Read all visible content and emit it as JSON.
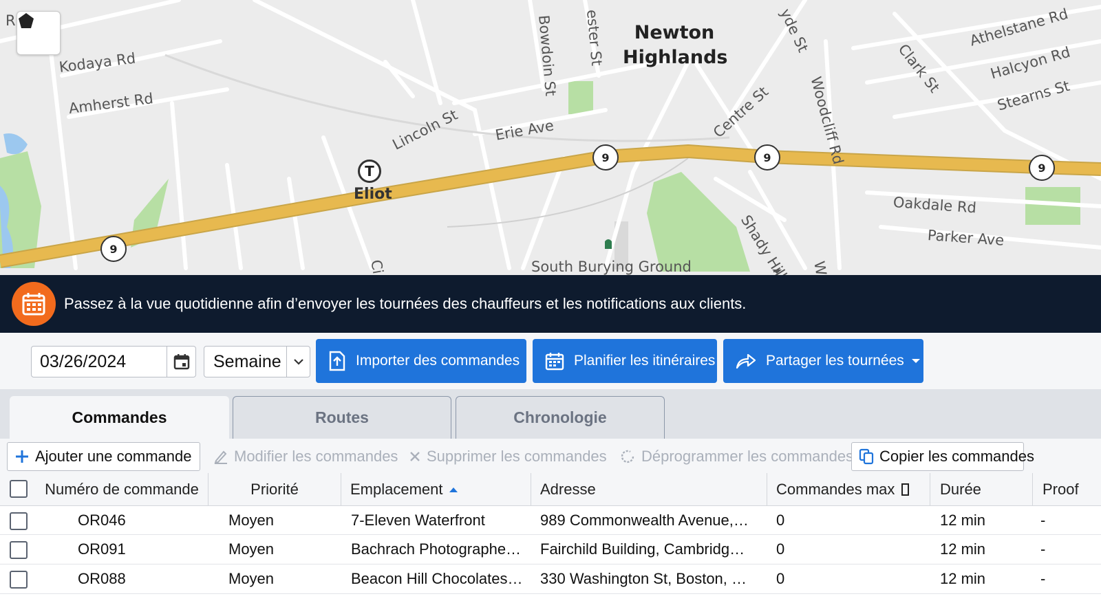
{
  "map": {
    "area_title": "Newton\nHighlands",
    "streets": {
      "kodaya": "Kodaya Rd",
      "amherst": "Amherst Rd",
      "lincoln": "Lincoln St",
      "erie": "Erie Ave",
      "bowdoin": "Bowdoin St",
      "chester": "ester St",
      "hyde": "yde St",
      "clark": "Clark St",
      "athelstane": "Athelstane Rd",
      "halcyon": "Halcyon Rd",
      "stearns": "Stearns St",
      "centre": "Centre St",
      "woodcliff": "Woodcliff Rd",
      "oakdale": "Oakdale Rd",
      "parker": "Parker Ave",
      "shady_hill": "Shady Hill",
      "south_burying": "South Burying Ground",
      "r_fragment": "R",
      "ci_fragment": "Ci",
      "w_fragment": "W"
    },
    "station": "Eliot",
    "station_icon": "T",
    "route_shield": "9",
    "shape_tool_icon": "pentagon-icon",
    "road_color": "#e7b94f",
    "park_color": "#b7dfa4",
    "water_color": "#9cc8ef"
  },
  "banner": {
    "icon": "calendar-icon",
    "text": "Passez à la vue quotidienne afin d’envoyer les tournées des chauffeurs et les notifications aux clients.",
    "color": "#0e1b2e",
    "icon_color": "#f26b1d"
  },
  "toolbar": {
    "date_value": "03/26/2024",
    "period_value": "Semaine",
    "import_label": "Importer des commandes",
    "plan_label": "Planifier les itinéraires",
    "share_label": "Partager les tournées",
    "button_color": "#1f74db"
  },
  "tabs": [
    {
      "label": "Commandes",
      "active": true
    },
    {
      "label": "Routes",
      "active": false
    },
    {
      "label": "Chronologie",
      "active": false
    }
  ],
  "actions": {
    "add": "Ajouter une commande",
    "edit": "Modifier les commandes",
    "delete": "Supprimer les commandes",
    "unschedule": "Déprogrammer les commandes",
    "copy": "Copier les commandes"
  },
  "table": {
    "columns": [
      "Numéro de commande",
      "Priorité",
      "Emplacement",
      "Adresse",
      "Commandes max",
      "Durée",
      "Proof"
    ],
    "sorted_column": "Emplacement",
    "rows": [
      {
        "id": "OR046",
        "priority": "Moyen",
        "location": "7-Eleven Waterfront",
        "address": "989 Commonwealth Avenue,…",
        "max": "0",
        "duration": "12 min",
        "proof": "-"
      },
      {
        "id": "OR091",
        "priority": "Moyen",
        "location": "Bachrach Photographe…",
        "address": "Fairchild Building, Cambridg…",
        "max": "0",
        "duration": "12 min",
        "proof": "-"
      },
      {
        "id": "OR088",
        "priority": "Moyen",
        "location": "Beacon Hill Chocolates…",
        "address": "330 Washington St, Boston, …",
        "max": "0",
        "duration": "12 min",
        "proof": "-"
      }
    ]
  }
}
